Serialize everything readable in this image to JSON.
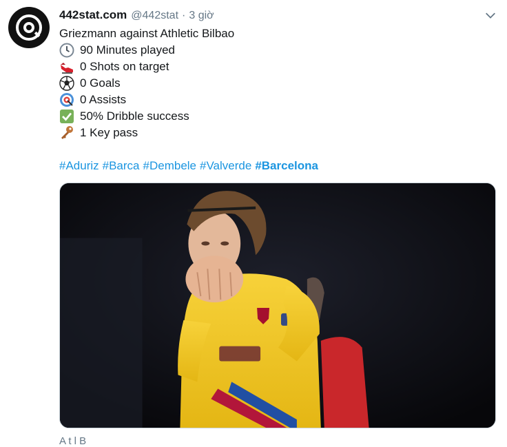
{
  "tweet": {
    "account_name": "442stat.com",
    "handle": "@442stat",
    "separator": "·",
    "time": "3 giờ",
    "intro": "Griezmann against Athletic Bilbao",
    "stats": [
      {
        "icon": "clock-icon",
        "text": "90 Minutes played"
      },
      {
        "icon": "football-boot-icon",
        "text": "0 Shots on target"
      },
      {
        "icon": "soccer-ball-icon",
        "text": "0 Goals"
      },
      {
        "icon": "target-icon",
        "text": "0 Assists"
      },
      {
        "icon": "check-box-icon",
        "text": "50% Dribble success"
      },
      {
        "icon": "key-icon",
        "text": "1 Key pass"
      }
    ],
    "hashtags": [
      "#Aduriz",
      "#Barca",
      "#Dembele",
      "#Valverde",
      "#Barcelona"
    ],
    "below_text": "A t l   B"
  },
  "colors": {
    "hashtag": "#1b95e0",
    "muted": "#657786",
    "text": "#14171a",
    "jersey": "#f2c31c"
  }
}
